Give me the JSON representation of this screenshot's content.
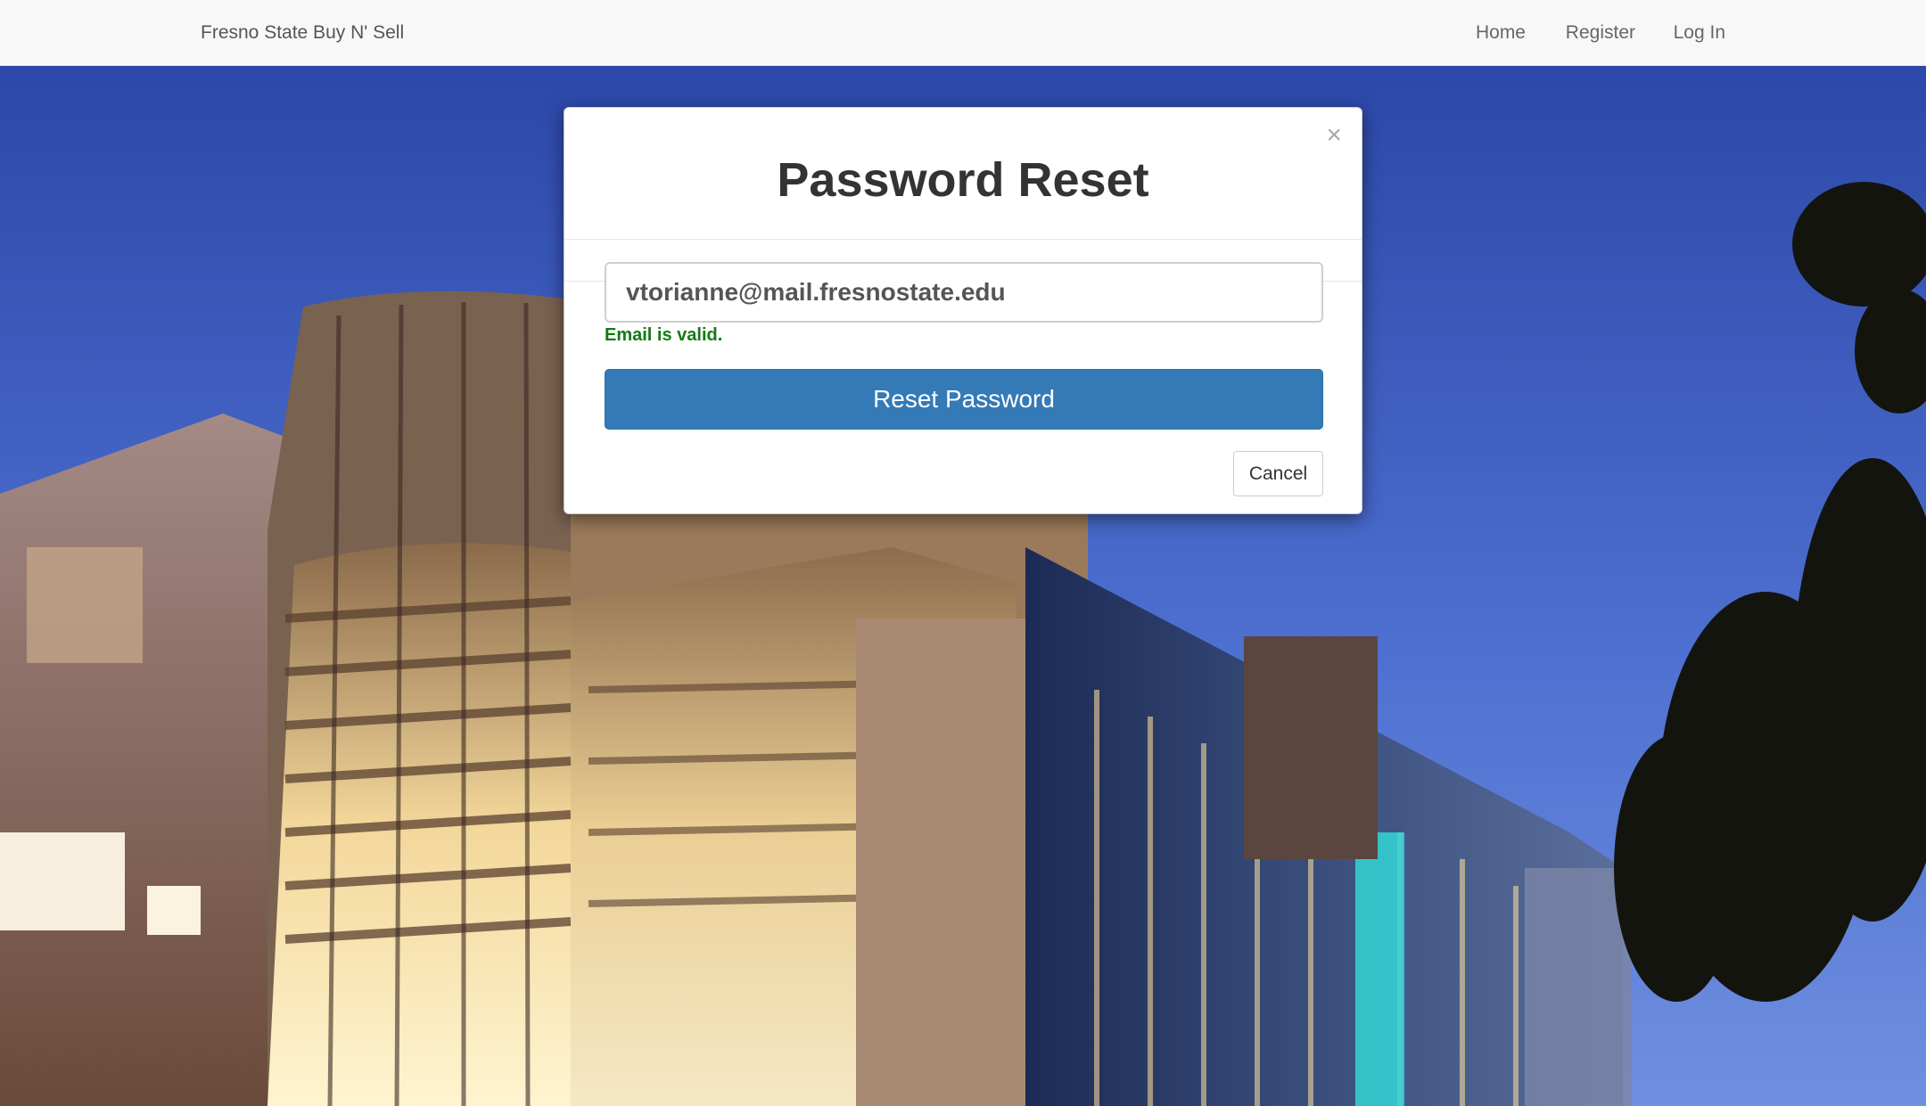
{
  "navbar": {
    "brand": "Fresno State Buy N' Sell",
    "links": [
      "Home",
      "Register",
      "Log In"
    ]
  },
  "modal": {
    "close_symbol": "×",
    "title": "Password Reset",
    "email_value": "vtorianne@mail.fresnostate.edu",
    "validation_message": "Email is valid.",
    "reset_button": "Reset Password",
    "cancel_button": "Cancel"
  },
  "colors": {
    "primary": "#337ab7",
    "valid_green": "#137a13",
    "navbar_bg": "#f8f8f8"
  },
  "icons": [
    "close-icon"
  ]
}
